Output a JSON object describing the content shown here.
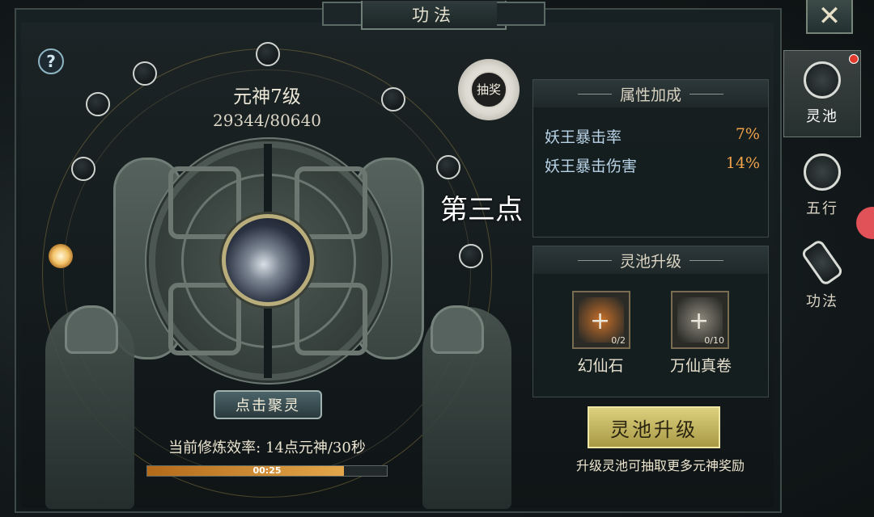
{
  "window": {
    "title": "功法",
    "close_icon": "close-x-icon"
  },
  "help": {
    "label": "?"
  },
  "realm": {
    "level_text": "元神7级",
    "exp_text": "29344/80640"
  },
  "draw": {
    "label": "抽奖"
  },
  "overlay": {
    "text": "第三点"
  },
  "gather": {
    "button_label": "点击聚灵"
  },
  "cultivation": {
    "rate_text": "当前修炼效率: 14点元神/30秒",
    "timer": "00:25",
    "progress": 0.82
  },
  "attributes": {
    "header": "属性加成",
    "rows": [
      {
        "name": "妖王暴击率",
        "value": "7%"
      },
      {
        "name": "妖王暴击伤害",
        "value": "14%"
      }
    ]
  },
  "upgrade": {
    "header": "灵池升级",
    "items": [
      {
        "name": "幻仙石",
        "count": "0/2",
        "color": "#c8702a"
      },
      {
        "name": "万仙真卷",
        "count": "0/10",
        "color": "#8f8a7e"
      }
    ],
    "button_label": "灵池升级",
    "hint": "升级灵池可抽取更多元神奖励"
  },
  "side_tabs": [
    {
      "label": "灵池",
      "icon": "spirit-pool-icon",
      "active": true,
      "badge": true
    },
    {
      "label": "五行",
      "icon": "five-elements-icon",
      "active": false,
      "badge": false
    },
    {
      "label": "功法",
      "icon": "scroll-icon",
      "active": false,
      "badge": false
    }
  ],
  "colors": {
    "accent_gold": "#dcd07e",
    "attr_value": "#f0a24a",
    "attr_name": "#b8d2e6"
  }
}
